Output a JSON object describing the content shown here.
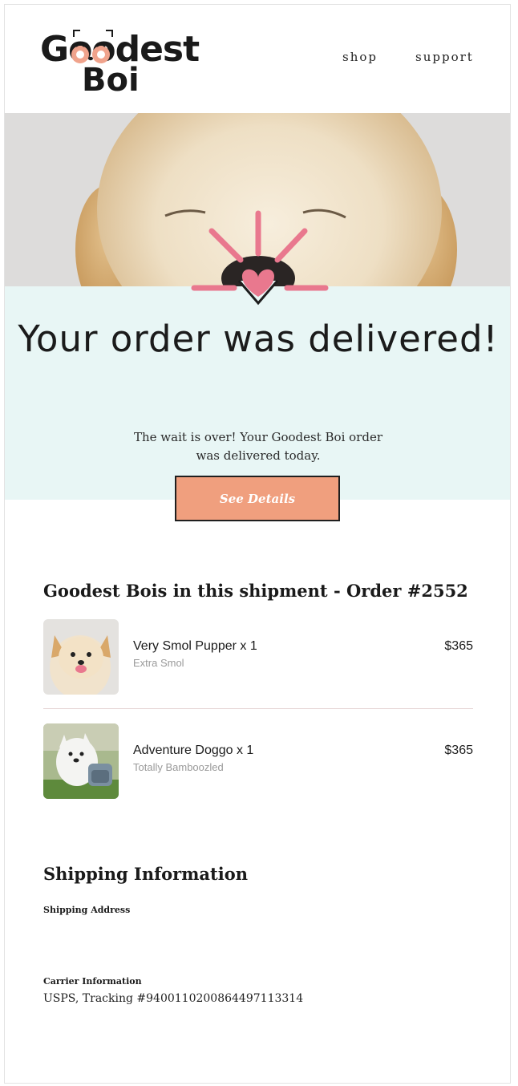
{
  "header": {
    "logo_line1": "Goodest",
    "logo_line2": "Boi",
    "nav": [
      "shop",
      "support"
    ]
  },
  "hero": {
    "title": "Your order was delivered!",
    "message": "The wait is over! Your Goodest Boi order was delivered today.",
    "button_label": "See Details"
  },
  "order": {
    "heading": "Goodest Bois in this shipment - Order #2552",
    "items": [
      {
        "name": "Very Smol Pupper x 1",
        "variant": "Extra Smol",
        "price": "$365"
      },
      {
        "name": "Adventure Doggo x 1",
        "variant": "Totally Bamboozled",
        "price": "$365"
      }
    ]
  },
  "shipping": {
    "heading": "Shipping Information",
    "address_label": "Shipping Address",
    "address_value": "",
    "carrier_label": "Carrier Information",
    "carrier_value": "USPS, Tracking #9400110200864497113314"
  },
  "colors": {
    "accent_pink": "#e9788e",
    "button_fill": "#f09f7e",
    "band_mint": "#e8f6f5"
  }
}
